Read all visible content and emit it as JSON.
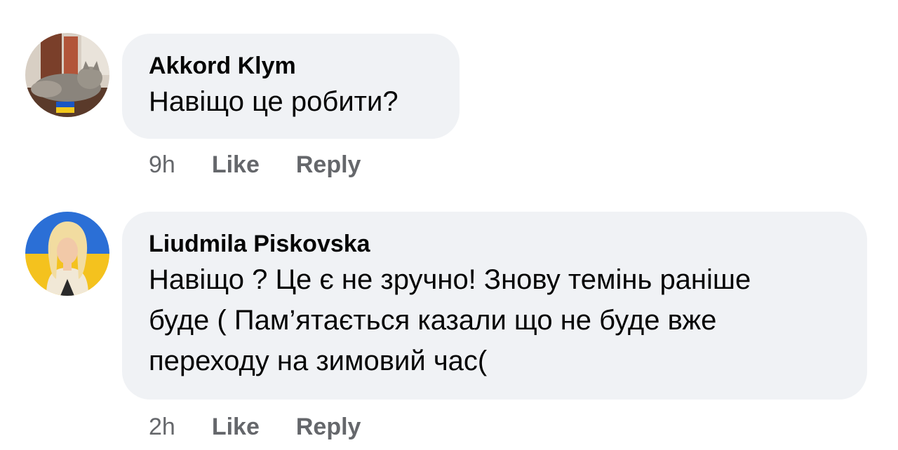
{
  "comments": [
    {
      "author": "Akkord Klym",
      "text": "Навіщо це робити?",
      "time": "9h",
      "like_label": "Like",
      "reply_label": "Reply"
    },
    {
      "author": "Liudmila Piskovska",
      "text": "Навіщо ? Це є не зручно! Знову темінь раніше\nбуде ( Пам’ятається казали що не буде вже\nпереходу на зимовий час(",
      "time": "2h",
      "like_label": "Like",
      "reply_label": "Reply"
    }
  ],
  "colors": {
    "bubble": "#f0f2f5",
    "meta": "#65676b",
    "text": "#050505"
  }
}
